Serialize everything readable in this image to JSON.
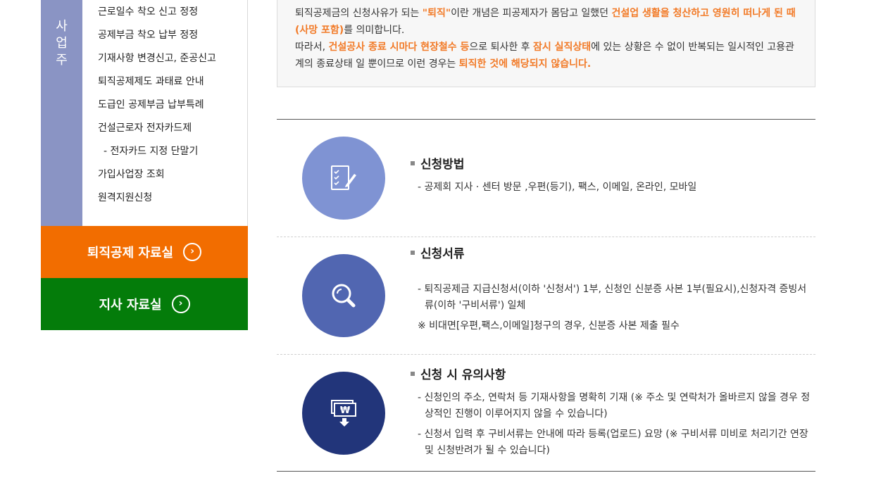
{
  "sidebar": {
    "tab_label": "사\n업\n주",
    "menu": [
      {
        "label": "근로일수 착오 신고 정정",
        "sub": false
      },
      {
        "label": "공제부금 착오 납부 정정",
        "sub": false
      },
      {
        "label": "기재사항 변경신고, 준공신고",
        "sub": false
      },
      {
        "label": "퇴직공제제도 과태료 안내",
        "sub": false
      },
      {
        "label": "도급인 공제부금 납부특례",
        "sub": false
      },
      {
        "label": "건설근로자 전자카드제",
        "sub": false
      },
      {
        "label": "- 전자카드 지정 단말기",
        "sub": true
      },
      {
        "label": "가입사업장 조회",
        "sub": false
      },
      {
        "label": "원격지원신청",
        "sub": false
      }
    ],
    "btn_resources": "퇴직공제 자료실",
    "btn_branch": "지사 자료실"
  },
  "notice": {
    "p1": {
      "a": "퇴직공제금의 신청사유가 되는 ",
      "b": "\"퇴직\"",
      "c": "이란 개념은 피공제자가 몸담고 일했던 ",
      "d": "건설업 생활을 청산하고 영원히 떠나게 된 때 (사망 포함)",
      "e": "를 의미합니다."
    },
    "p2": {
      "a": "따라서, ",
      "b": "건설공사 종료 시마다 현장철수 등",
      "c": "으로 퇴사한 후 ",
      "d": "잠시 실직상태",
      "e": "에 있는 상황은 수 없이 반복되는 일시적인 고용관계의 종료상태 일 뿐이므로 이런 경우는 ",
      "f": "퇴직한 것에 해당되지 않습니다."
    }
  },
  "sections": {
    "method": {
      "title": "신청방법",
      "lines": [
        "- 공제회 지사 · 센터 방문 ,우편(등기), 팩스, 이메일, 온라인, 모바일"
      ]
    },
    "documents": {
      "title": "신청서류",
      "lines": [
        "- 퇴직공제금 지급신청서(이하 '신청서') 1부, 신청인 신분증 사본 1부(필요시),신청자격 증빙서류(이하 '구비서류') 일체",
        "※ 비대면[우편,팩스,이메일]청구의 경우, 신분증 사본 제출 필수"
      ]
    },
    "caution": {
      "title": "신청 시 유의사항",
      "lines": [
        "- 신청인의 주소, 연락처 등 기재사항을 명확히 기재 (※ 주소 및 연락처가 올바르지 않을 경우 정상적인 진행이 이루어지지 않을 수 있습니다)",
        "- 신청서 입력 후 구비서류는 안내에 따라 등록(업로드) 요망 (※ 구비서류 미비로 처리기간 연장 및 신청반려가 될 수 있습니다)"
      ]
    }
  },
  "colors": {
    "sidebar_tab": "#8a94c4",
    "btn_orange": "#f26d00",
    "btn_green": "#047c0a",
    "highlight": "#f27a27",
    "circle1": "#7f93d3",
    "circle2": "#5166b1",
    "circle3": "#22357a"
  },
  "icons": {
    "method": "checklist-pen-icon",
    "documents": "magnifier-icon",
    "caution": "won-bill-download-icon"
  }
}
